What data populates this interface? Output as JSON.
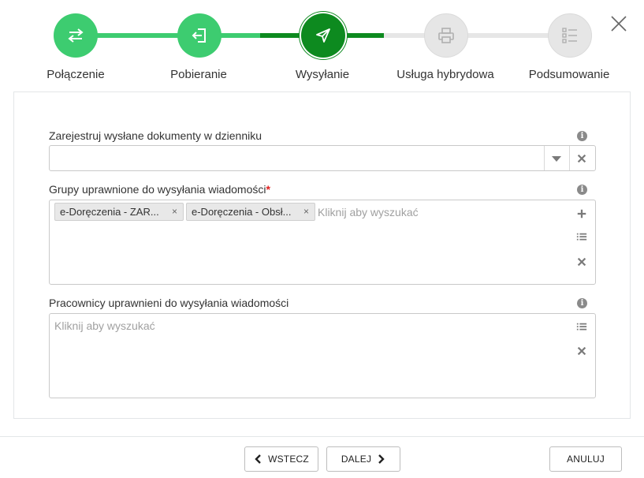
{
  "stepper": {
    "steps": [
      {
        "label": "Połączenie",
        "state": "done",
        "icon": "transfer-arrows-icon"
      },
      {
        "label": "Pobieranie",
        "state": "done",
        "icon": "sign-in-icon"
      },
      {
        "label": "Wysyłanie",
        "state": "active",
        "icon": "paper-plane-icon"
      },
      {
        "label": "Usługa hybrydowa",
        "state": "todo",
        "icon": "printer-icon"
      },
      {
        "label": "Podsumowanie",
        "state": "todo",
        "icon": "checklist-icon"
      }
    ]
  },
  "form": {
    "register_label": "Zarejestruj wysłane dokumenty w dzienniku",
    "register_value": "",
    "groups_label": "Grupy uprawnione do wysyłania wiadomości",
    "groups_required_mark": "*",
    "groups_tags": [
      {
        "label": "e-Doręczenia - ZAR..."
      },
      {
        "label": "e-Doręczenia - Obsł..."
      }
    ],
    "tag_remove_symbol": "×",
    "groups_placeholder": "Kliknij aby wyszukać",
    "workers_label": "Pracownicy uprawnieni do wysyłania wiadomości",
    "workers_placeholder": "Kliknij aby wyszukać"
  },
  "footer": {
    "back_label": "WSTECZ",
    "next_label": "DALEJ",
    "cancel_label": "ANULUJ"
  },
  "colors": {
    "done": "#3dcc70",
    "active": "#0d8a1f",
    "todo": "#e6e6e6",
    "required": "#e0201f"
  }
}
